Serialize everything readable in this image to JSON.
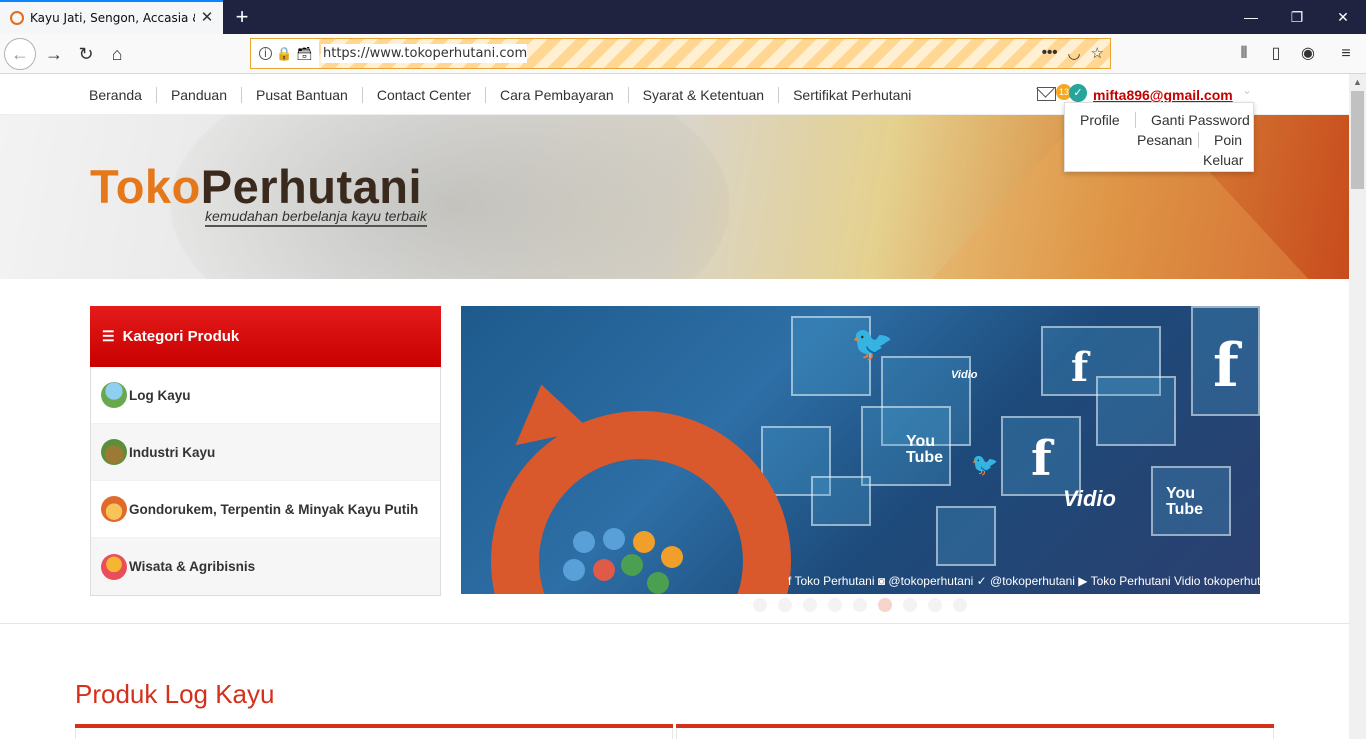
{
  "browser": {
    "tab_title": "Kayu Jati, Sengon, Accasia & La",
    "url": "https://www.tokoperhutani.com",
    "new_tab_label": "+",
    "url_menu_icon": "•••"
  },
  "nav": {
    "items": [
      "Beranda",
      "Panduan",
      "Pusat Bantuan",
      "Contact Center",
      "Cara Pembayaran",
      "Syarat & Ketentuan",
      "Sertifikat Perhutani"
    ]
  },
  "user": {
    "notif_count": "13",
    "email": "mifta896@gmail.com",
    "menu": {
      "profile": "Profile",
      "password": "Ganti Password",
      "orders": "Pesanan",
      "points": "Poin",
      "logout": "Keluar"
    }
  },
  "banner": {
    "logo_toko": "Toko",
    "logo_perhutani": "Perhutani",
    "tagline": "kemudahan berbelanja kayu terbaik"
  },
  "categories": {
    "title": "Kategori Produk",
    "items": [
      {
        "label": "Log Kayu",
        "color": "#6aa84f"
      },
      {
        "label": "Industri Kayu",
        "color": "#9c7a35"
      },
      {
        "label": "Gondorukem, Terpentin & Minyak Kayu Putih",
        "color": "#e06a2c"
      },
      {
        "label": "Wisata & Agribisnis",
        "color": "#e94e5a"
      }
    ]
  },
  "slider": {
    "caption": "f Toko Perhutani   ◙ @tokoperhutani   ✓ @tokoperhutani   ▶ Toko Perhutani   Vidio tokoperhutani",
    "glyphs": {
      "twitter": "🐦",
      "facebook": "f",
      "youtube": "You\nTube",
      "vidio": "Vidio"
    },
    "slides": 9,
    "active_slide": 6
  },
  "products": {
    "title": "Produk Log Kayu"
  },
  "colors": {
    "accent": "#d4301a",
    "brand_orange": "#e5781b",
    "header_red": "#c80000"
  }
}
